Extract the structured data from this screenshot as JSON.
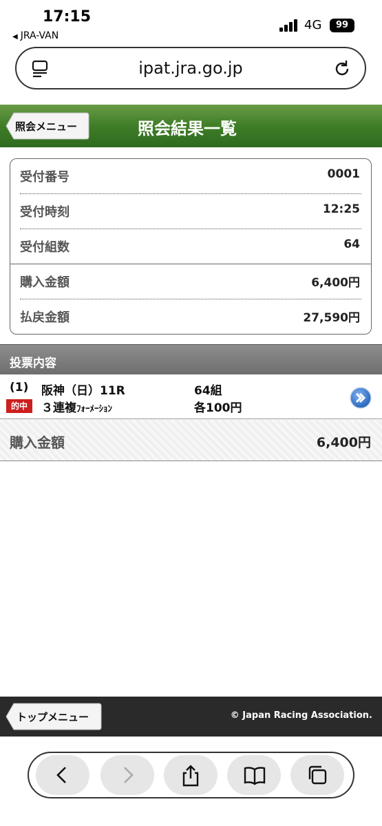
{
  "status_bar": {
    "time": "17:15",
    "back_app": "JRA-VAN",
    "network": "4G",
    "battery": "99"
  },
  "browser": {
    "url": "ipat.jra.go.jp"
  },
  "header": {
    "back_button": "照会メニュー",
    "title": "照会結果一覧"
  },
  "summary": {
    "rows": [
      {
        "label": "受付番号",
        "value": "0001"
      },
      {
        "label": "受付時刻",
        "value": "12:25"
      },
      {
        "label": "受付組数",
        "value": "64"
      },
      {
        "label": "購入金額",
        "value": "6,400円"
      },
      {
        "label": "払戻金額",
        "value": "27,590円"
      }
    ]
  },
  "section": {
    "title": "投票内容"
  },
  "bet": {
    "number": "(1)",
    "race": "阪神（日）11R",
    "combos": "64組",
    "hit_badge": "的中",
    "type_main": "３連複",
    "type_sub": "ﾌｫｰﾒｰｼｮﾝ",
    "unit": "各100円"
  },
  "total": {
    "label": "購入金額",
    "value": "6,400円"
  },
  "footer": {
    "top_button": "トップメニュー",
    "copyright": "© Japan Racing Association."
  },
  "colors": {
    "header_green": "#3f7d27",
    "hit_red": "#cc1f1f",
    "footer_dark": "#2a2a2a"
  }
}
